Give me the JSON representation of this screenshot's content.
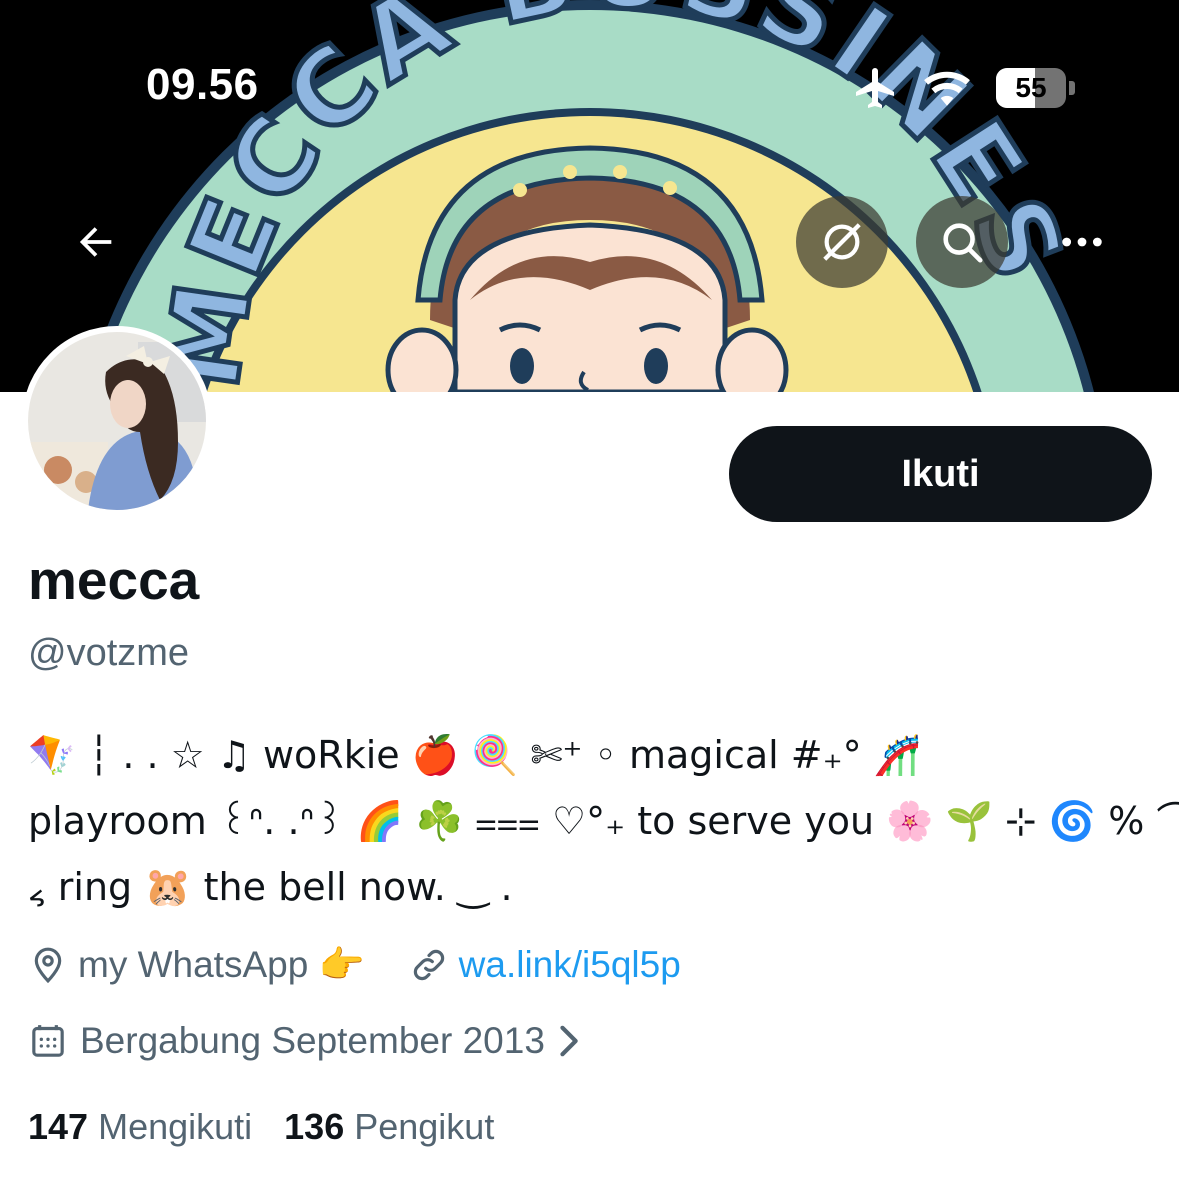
{
  "status_bar": {
    "time": "09.56",
    "battery": "55",
    "battery_level": 0.55,
    "icons": [
      "airplane-icon",
      "wifi-icon",
      "battery-icon"
    ]
  },
  "header": {
    "banner_title": "MECCA BUSSINES",
    "actions": [
      "back-arrow-icon",
      "grok-icon",
      "search-icon",
      "more-icon"
    ]
  },
  "profile": {
    "follow_label": "Ikuti",
    "display_name": "mecca",
    "handle": "@votzme",
    "bio_lines": [
      "🪁 ┆ . . ☆ ♫ woRkie 🍎 🍭 ✄⁺ ◦ magical #₊° 🎢",
      "playroom ꒰ᐢ. .ᐢ꒱ 🌈 ☘️ ⩶ ♡°₊ to serve you 🌸 🌱 ⊹ 🌀 % ⌒",
      "៹ ring 🐹 the bell now. ‿ ."
    ],
    "location": "my WhatsApp 👉",
    "website": "wa.link/i5ql5p",
    "joined": "Bergabung September 2013",
    "following_count": "147",
    "following_label": "Mengikuti",
    "followers_count": "136",
    "followers_label": "Pengikut"
  },
  "colors": {
    "text": "#0f1419",
    "muted": "#536471",
    "link": "#1d9bf0",
    "banner_ring": "#a8dcc6",
    "banner_yellow": "#f6e690",
    "banner_text": "#e8d174"
  }
}
